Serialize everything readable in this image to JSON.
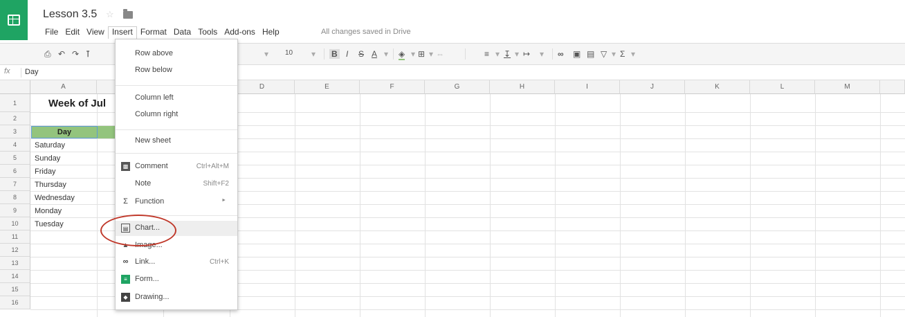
{
  "doc": {
    "title": "Lesson 3.5",
    "save_status": "All changes saved in Drive"
  },
  "menubar": [
    "File",
    "Edit",
    "View",
    "Insert",
    "Format",
    "Data",
    "Tools",
    "Add-ons",
    "Help"
  ],
  "toolbar": {
    "font_size": "10",
    "bold": "B",
    "italic": "I",
    "strike": "S",
    "text_color": "A"
  },
  "formula_bar": {
    "fx": "fx",
    "value": "Day"
  },
  "columns": [
    "A",
    "B",
    "C",
    "D",
    "E",
    "F",
    "G",
    "H",
    "I",
    "J",
    "K",
    "L",
    "M"
  ],
  "rows": [
    "1",
    "2",
    "3",
    "4",
    "5",
    "6",
    "7",
    "8",
    "9",
    "10",
    "11",
    "12",
    "13",
    "14",
    "15",
    "16"
  ],
  "cells": {
    "title": "Week of Jul",
    "day_header": "Day",
    "days": [
      "Saturday",
      "Sunday",
      "Friday",
      "Thursday",
      "Wednesday",
      "Monday",
      "Tuesday"
    ]
  },
  "insert_menu": {
    "row_above": "Row above",
    "row_below": "Row below",
    "column_left": "Column left",
    "column_right": "Column right",
    "new_sheet": "New sheet",
    "comment": "Comment",
    "comment_shortcut": "Ctrl+Alt+M",
    "note": "Note",
    "note_shortcut": "Shift+F2",
    "function": "Function",
    "function_arrow": "►",
    "chart": "Chart...",
    "image": "Image...",
    "link": "Link...",
    "link_shortcut": "Ctrl+K",
    "form": "Form...",
    "drawing": "Drawing..."
  },
  "colors": {
    "brand_green": "#1fa463",
    "header_fill": "#93c47d",
    "annotation": "#c0392b"
  }
}
